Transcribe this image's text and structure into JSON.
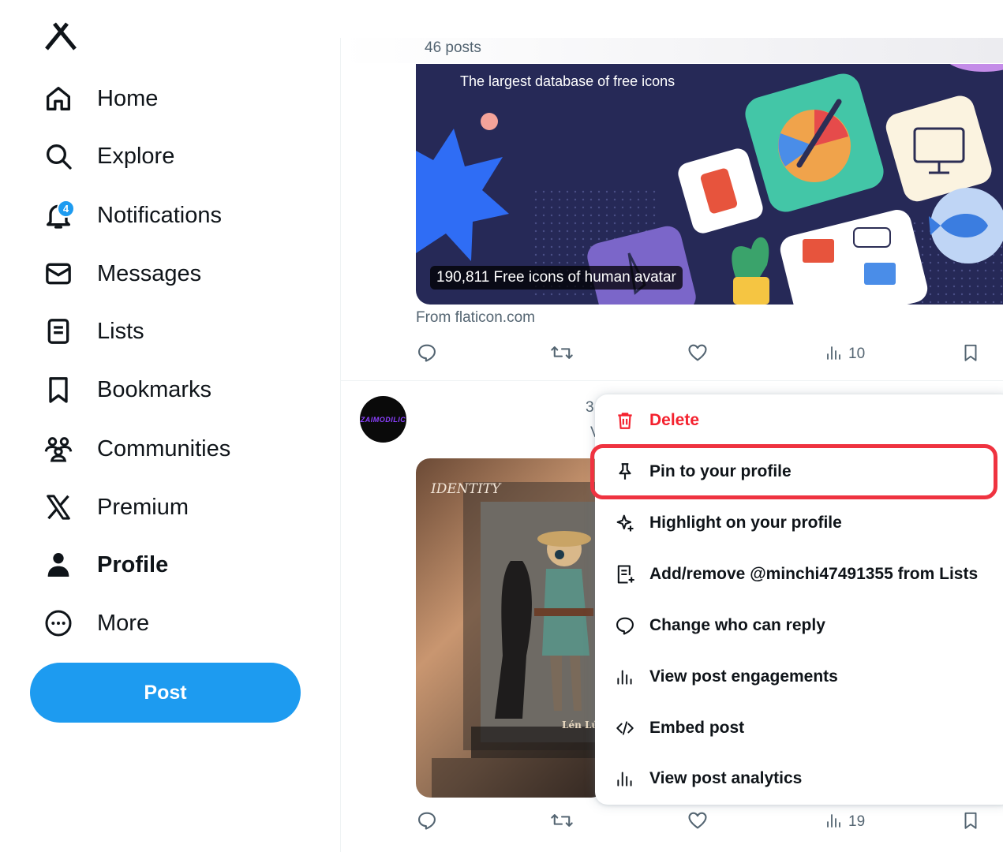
{
  "colors": {
    "accent": "#1d9bf0",
    "danger": "#f4212e",
    "highlight_ring": "#ef3340",
    "muted": "#536471"
  },
  "sidebar": {
    "logo_icon": "x-logo-icon",
    "items": [
      {
        "label": "Home",
        "icon": "home-icon"
      },
      {
        "label": "Explore",
        "icon": "search-icon"
      },
      {
        "label": "Notifications",
        "icon": "bell-icon",
        "badge": "4"
      },
      {
        "label": "Messages",
        "icon": "envelope-icon"
      },
      {
        "label": "Lists",
        "icon": "list-icon"
      },
      {
        "label": "Bookmarks",
        "icon": "bookmark-icon"
      },
      {
        "label": "Communities",
        "icon": "people-icon"
      },
      {
        "label": "Premium",
        "icon": "x-icon"
      },
      {
        "label": "Profile",
        "icon": "person-icon",
        "active": true
      },
      {
        "label": "More",
        "icon": "more-circle-icon"
      }
    ],
    "post_button": "Post"
  },
  "header": {
    "posts_count": "46 posts"
  },
  "card": {
    "caption": "The largest database of free icons",
    "overlay": "190,811 Free icons of human avatar",
    "source": "From flaticon.com"
  },
  "post1": {
    "views": "10"
  },
  "post2": {
    "avatar_text": "ZAIMODILIC",
    "meta_fragment": "3",
    "meta_fragment2": "V",
    "media_title": "IDENTITY",
    "media_tag": "Lén Lút",
    "views": "19"
  },
  "menu": {
    "items": [
      {
        "label": "Delete",
        "icon": "trash-icon"
      },
      {
        "label": "Pin to your profile",
        "icon": "pin-icon"
      },
      {
        "label": "Highlight on your profile",
        "icon": "sparkle-icon"
      },
      {
        "label": "Add/remove @minchi47491355 from Lists",
        "icon": "list-add-icon"
      },
      {
        "label": "Change who can reply",
        "icon": "reply-bubble-icon"
      },
      {
        "label": "View post engagements",
        "icon": "bar-chart-icon"
      },
      {
        "label": "Embed post",
        "icon": "code-icon"
      },
      {
        "label": "View post analytics",
        "icon": "bar-chart-icon"
      }
    ]
  }
}
